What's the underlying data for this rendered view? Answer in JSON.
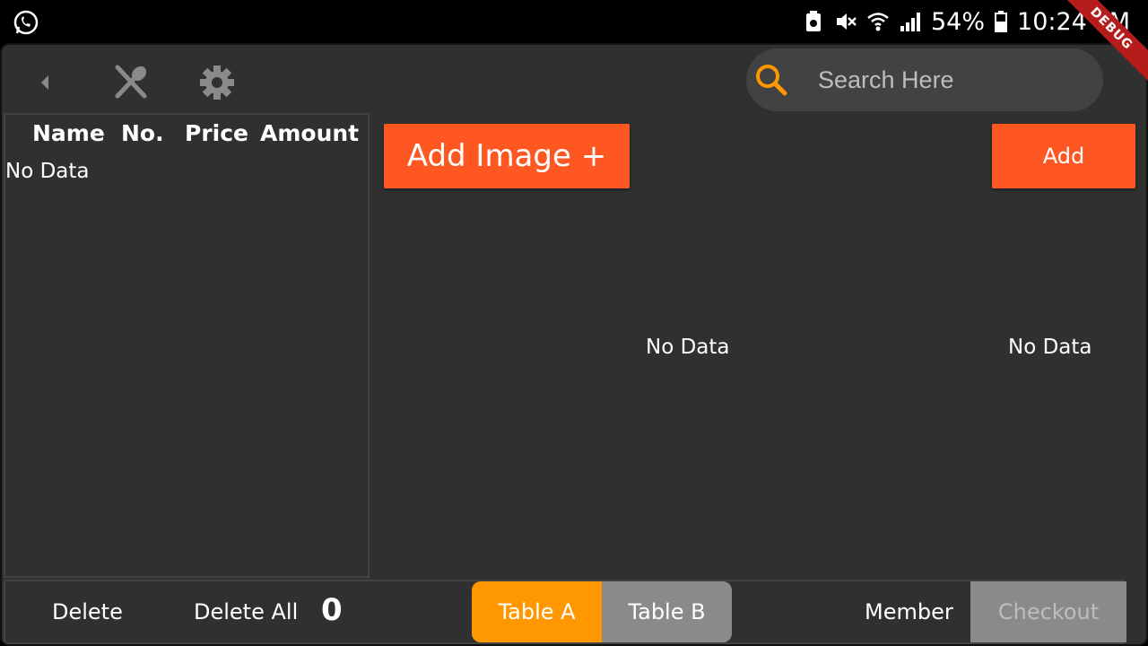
{
  "status_bar": {
    "battery_percent": "54%",
    "time": "10:24 PM",
    "debug_banner": "DEBUG",
    "icons": [
      "whatsapp-icon",
      "battery-saver-icon",
      "mute-icon",
      "wifi-icon",
      "signal-icon",
      "battery-icon"
    ]
  },
  "toolbar": {
    "icons": [
      "back-arrow-icon",
      "utensils-icon",
      "gear-icon"
    ],
    "search_placeholder": "Search Here",
    "accent_color": "#ff9800"
  },
  "order_panel": {
    "columns": [
      "Name",
      "No.",
      "Price",
      "Amount"
    ],
    "empty_text": "No Data"
  },
  "main": {
    "add_image_label": "Add Image +",
    "add_label": "Add",
    "empty_center": "No Data",
    "empty_right": "No Data",
    "button_color": "#ff5722"
  },
  "bottom_bar": {
    "delete_label": "Delete",
    "delete_all_label": "Delete All",
    "count": "0",
    "tables": [
      "Table A",
      "Table B"
    ],
    "active_table": "Table A",
    "member_label": "Member",
    "checkout_label": "Checkout"
  }
}
